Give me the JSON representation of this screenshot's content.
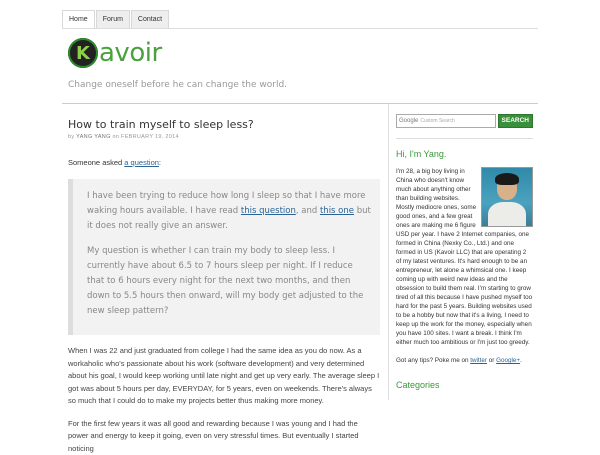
{
  "nav": {
    "tabs": [
      "Home",
      "Forum",
      "Contact"
    ]
  },
  "site": {
    "logo_k": "K",
    "logo_rest": "avoir",
    "tagline": "Change oneself before he can change the world."
  },
  "post": {
    "title": "How to train myself to sleep less?",
    "meta_prefix": "by",
    "author": "YANG YANG",
    "meta_on": "on",
    "date": "FEBRUARY 19, 2014",
    "lead_text": "Someone asked",
    "lead_link": "a question",
    "lead_end": ":",
    "quote1_a": "I have been trying to reduce how long I sleep so that I have more waking hours available. I have read",
    "quote1_link1": "this question",
    "quote1_b": ", and",
    "quote1_link2": "this one",
    "quote1_c": "but it does not really give an answer.",
    "quote2": "My question is whether I can train my body to sleep less. I currently have about 6.5 to 7 hours sleep per night. If I reduce that to 6 hours every night for the next two months, and then down to 5.5 hours then onward, will my body get adjusted to the new sleep pattern?",
    "para1": "When I was 22 and just graduated from college I had the same idea as you do now. As a workaholic who's passionate about his work (software development) and very determined about his goal, I would keep working until late night and get up very early. The average sleep I got was about 5 hours per day, EVERYDAY, for 5 years, even on weekends. There's always so much that I could do to make my projects better thus making more money.",
    "para2": "For the first few years it was all good and rewarding because I was young and I had the power and energy to keep it going, even on very stressful times. But eventually I started noticing"
  },
  "sidebar": {
    "search_placeholder": "Custom Search",
    "search_google": "Google",
    "search_button": "SEARCH",
    "greeting": "Hi, I'm Yang.",
    "bio": "I'm 28, a big boy living in China who doesn't know much about anything other than building websites. Mostly mediocre ones, some good ones, and a few great ones are making me 6 figure USD per year. I have 2 Internet companies, one formed in China (Nexky Co., Ltd.) and one formed in US (Kavoir LLC) that are operating 2 of my latest ventures. It's hard enough to be an entrepreneur, let alone a whimsical one. I keep coming up with weird new ideas and the obsession to build them real. I'm starting to grow tired of all this because I have pushed myself too hard for the past 5 years. Building websites used to be a hobby but now that it's a living, I need to keep up the work for the money, especially when you have 100 sites. I want a break. I think I'm either much too ambitious or I'm just too greedy.",
    "tips_text": "Got any tips? Poke me on",
    "tips_link1": "twitter",
    "tips_or": "or",
    "tips_link2": "Google+",
    "tips_end": ".",
    "categories_heading": "Categories"
  }
}
